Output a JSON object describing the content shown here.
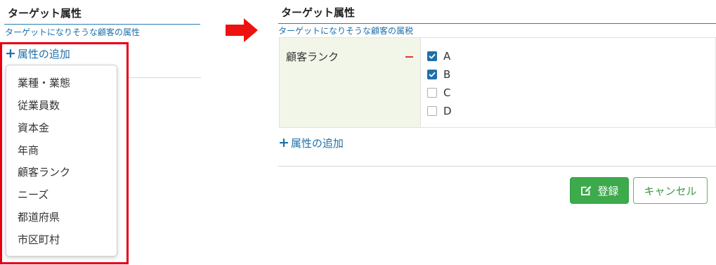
{
  "left_panel": {
    "title": "ターゲット属性",
    "subtitle": "ターゲットになりそうな顧客の属性",
    "add_attribute": {
      "plus": "+",
      "label": "属性の追加"
    },
    "dropdown_items": [
      "業種・業態",
      "従業員数",
      "資本金",
      "年商",
      "顧客ランク",
      "ニーズ",
      "都道府県",
      "市区町村"
    ]
  },
  "arrow": {
    "icon": "right-arrow-icon",
    "color": "#ee1111"
  },
  "right_panel": {
    "title": "ターゲット属性",
    "subtitle": "ターゲットになりそうな顧客の属税",
    "attribute": {
      "name": "顧客ランク",
      "remove_icon": "minus-icon",
      "options": [
        {
          "label": "A",
          "checked": true
        },
        {
          "label": "B",
          "checked": true
        },
        {
          "label": "C",
          "checked": false
        },
        {
          "label": "D",
          "checked": false
        }
      ]
    },
    "add_attribute": {
      "plus": "+",
      "label": "属性の追加"
    },
    "buttons": {
      "register": "登録",
      "register_icon": "edit-icon",
      "cancel": "キャンセル"
    }
  },
  "colors": {
    "link": "#1e6fa8",
    "highlight_frame": "#e60012",
    "checkbox_checked": "#1f6fa8",
    "attribute_cell_bg": "#f1f6e9",
    "primary_button": "#3daa4c",
    "remove_icon": "#e8312a"
  }
}
